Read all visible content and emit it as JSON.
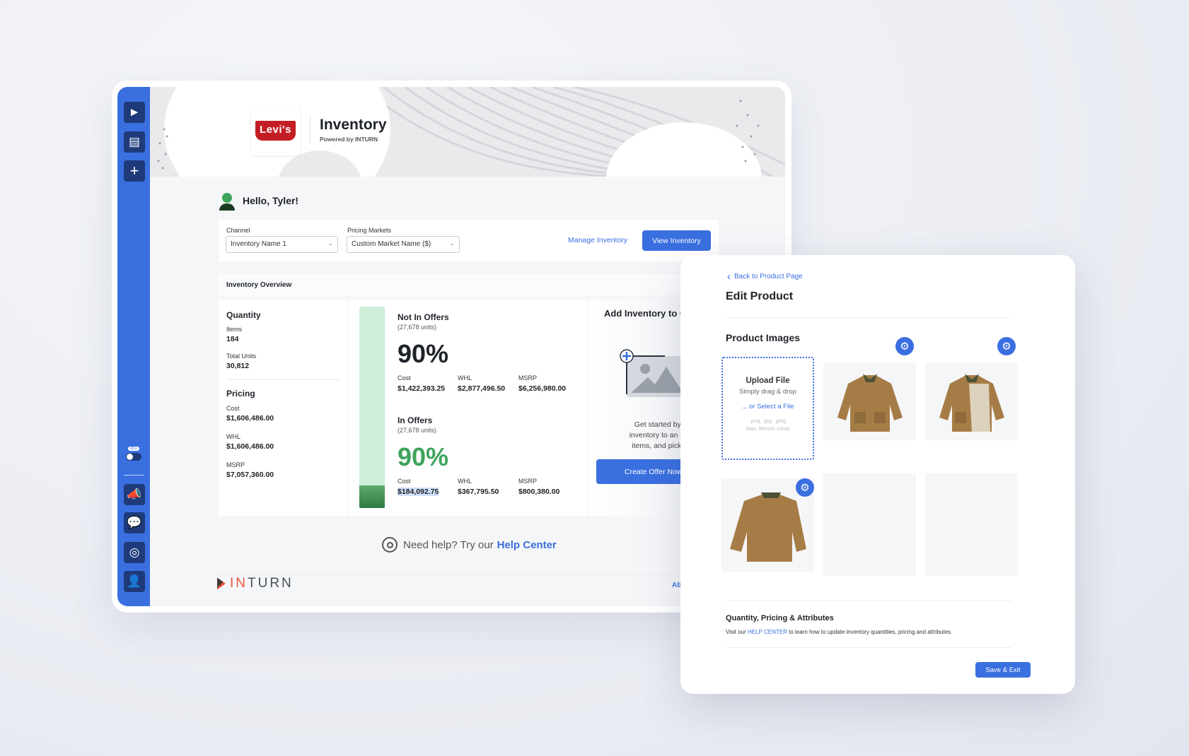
{
  "sidebar": {
    "items": [
      {
        "icon": "inturn-logo-icon"
      },
      {
        "icon": "receipt-icon"
      },
      {
        "icon": "plus-icon"
      },
      {
        "icon": "megaphone-icon"
      },
      {
        "icon": "chat-icon"
      },
      {
        "icon": "lifebuoy-icon"
      },
      {
        "icon": "user-icon"
      }
    ],
    "toggle_badge": "v01"
  },
  "header": {
    "brand_logo": "Levi's",
    "title": "Inventory",
    "subtitle": "Powered by INTURN"
  },
  "greeting": "Hello, Tyler!",
  "filters": {
    "channel_label": "Channel",
    "channel_value": "Inventory Name 1",
    "markets_label": "Pricing Markets",
    "markets_value": "Custom Market Name ($)",
    "manage_link": "Manage Inventory",
    "view_button": "View Inventory"
  },
  "overview": {
    "title": "Inventory Overview",
    "quantity": {
      "heading": "Quantity",
      "items_label": "Items",
      "items_value": "184",
      "units_label": "Total Units",
      "units_value": "30,812"
    },
    "pricing": {
      "heading": "Pricing",
      "cost_label": "Cost",
      "cost_value": "$1,606,486.00",
      "whl_label": "WHL",
      "whl_value": "$1,606,486.00",
      "msrp_label": "MSRP",
      "msrp_value": "$7,057,360.00"
    },
    "bar_in_offers_fraction": 0.1,
    "not_in_offers": {
      "heading": "Not In Offers",
      "units": "(27,678 units)",
      "percent": "90%",
      "cost_label": "Cost",
      "cost": "$1,422,393.25",
      "whl_label": "WHL",
      "whl": "$2,877,496.50",
      "msrp_label": "MSRP",
      "msrp": "$6,256,980.00"
    },
    "in_offers": {
      "heading": "In Offers",
      "units": "(27,678 units)",
      "percent": "90%",
      "cost_label": "Cost",
      "cost": "$184,092.75",
      "whl_label": "WHL",
      "whl": "$367,795.50",
      "msrp_label": "MSRP",
      "msrp": "$800,380.00"
    },
    "add": {
      "heading": "Add Inventory to C",
      "line1": "Get started by adding",
      "line2": "inventory to an offer, pric",
      "line3": "items, and picking your",
      "button": "Create Offer Now"
    }
  },
  "help": {
    "text": "Need help? Try our",
    "link": "Help Center"
  },
  "footer": {
    "logo_in": "IN",
    "logo_turn": "TURN",
    "link": "Ab"
  },
  "edit": {
    "back": "Back to Product Page",
    "title": "Edit Product",
    "images_heading": "Product Images",
    "upload": {
      "title": "Upload File",
      "hint": "Simply drag & drop",
      "select": "... or Select a File",
      "formats": ".png, .jpg, .jpeg",
      "max": "Max. filesize 10mb"
    },
    "attrs_heading": "Quantity, Pricing & Attributes",
    "attrs_pre": "Visit our",
    "attrs_link": "HELP CENTER",
    "attrs_post": "to learn how to update inventory quantities, pricing and attributes.",
    "save": "Save & Exit"
  },
  "colors": {
    "accent": "#3a6fe0",
    "green": "#3fa45b",
    "levis_red": "#c41e24",
    "inturn_orange": "#e8573a"
  }
}
